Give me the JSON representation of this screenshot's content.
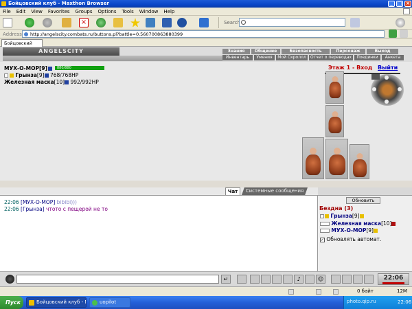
{
  "window": {
    "title": "Бойцовский клуб - Maxthon Browser"
  },
  "menu": [
    "File",
    "Edit",
    "View",
    "Favorites",
    "Groups",
    "Options",
    "Tools",
    "Window",
    "Help"
  ],
  "search": {
    "label": "Search"
  },
  "address": {
    "label": "Address",
    "url": "http://angelscity.combats.ru/buttons.pl?battle=0.560700863880399"
  },
  "tab": {
    "label": "Бойцовский клуб"
  },
  "game": {
    "logo": "ANGELSCITY",
    "nav_top": [
      "Знания",
      "Общение",
      "Безопасность",
      "Персонаж",
      "Выход"
    ],
    "nav_bottom": [
      "Инвентарь",
      "Умения",
      "Мой Скроллл",
      "Отчет о переводах",
      "Поединки",
      "Анкета"
    ],
    "player": {
      "name": "МУХ-О-МОР",
      "level": "[9]",
      "hp": "880/880"
    },
    "companions": [
      {
        "name": "Грынза",
        "level": "[9]",
        "hp": "768/768HP"
      },
      {
        "name": "Железная маска",
        "level": "[10]",
        "hp": "992/992HP"
      }
    ],
    "location": "Этаж 1 - Вход",
    "exit": "Выйти"
  },
  "chat": {
    "tab_chat": "Чат",
    "tab_system": "Системные сообщения",
    "lines": [
      {
        "time": "22:06",
        "user": "[МУХ-О-МОР]",
        "text": "bibibi)))"
      },
      {
        "time": "22:06",
        "user": "[Грынза]",
        "text": "чтото с пещерой не то"
      }
    ]
  },
  "room": {
    "refresh": "Обновить",
    "title": "Бездна",
    "count": "(3)",
    "members": [
      {
        "name": "Грынза",
        "level": "[9]"
      },
      {
        "name": "Железная маска",
        "level": "[10]"
      },
      {
        "name": "МУХ-О-МОР",
        "level": "[9]"
      }
    ],
    "auto_label": "Обновлять автомат."
  },
  "clock": {
    "time": "22:06"
  },
  "status": {
    "bytes": "0 байт",
    "mem": "12M"
  },
  "taskbar": {
    "start": "Пуск",
    "task1": "Бойцовский клуб - M...",
    "task2": "uopilot",
    "time": "22:06",
    "watermark": "photo.qip.ru"
  }
}
